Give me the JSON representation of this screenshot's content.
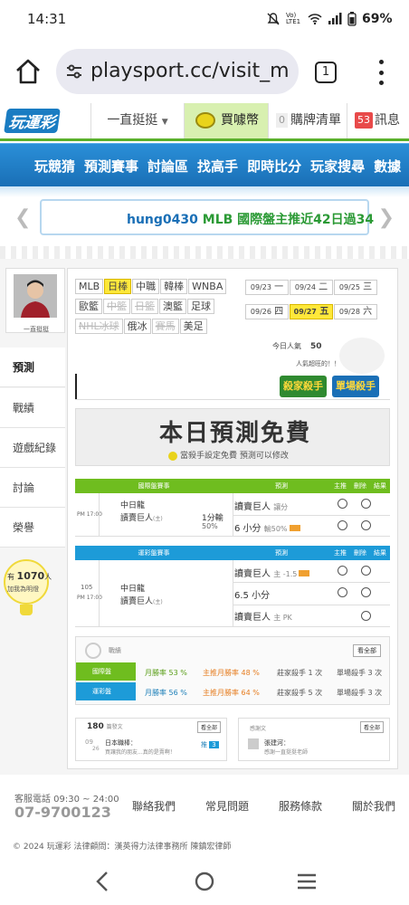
{
  "status": {
    "time": "14:31",
    "signal_text": "Vo) LTE1",
    "battery": "69%"
  },
  "browser": {
    "url": "playsport.cc/visit_m",
    "tab_count": "1"
  },
  "site": {
    "logo": "玩運彩",
    "dropdown": "一直挺挺",
    "buy": "買噱幣",
    "cart_count": "0",
    "cart": "購牌清單",
    "msg_count": "53",
    "msg": "訊息"
  },
  "nav": [
    "玩競猜",
    "預測賽事",
    "討論區",
    "找高手",
    "即時比分",
    "玩家搜尋",
    "數據"
  ],
  "ticker": {
    "user": "hung0430",
    "text": "MLB 國際盤主推近42日過34"
  },
  "profile": {
    "name": "一直挺挺"
  },
  "sidebar": [
    "預測",
    "戰績",
    "遊戲紀錄",
    "討論",
    "榮譽"
  ],
  "bulb": {
    "count": "1070",
    "unit": "人",
    "line2": "加我為明燈"
  },
  "leagues": [
    {
      "label": "MLB",
      "state": "normal"
    },
    {
      "label": "日棒",
      "state": "selected"
    },
    {
      "label": "中職",
      "state": "normal"
    },
    {
      "label": "韓棒",
      "state": "normal"
    },
    {
      "label": "WNBA",
      "state": "normal"
    },
    {
      "label": "歐籃",
      "state": "normal"
    },
    {
      "label": "中籃",
      "state": "disabled"
    },
    {
      "label": "日籃",
      "state": "disabled"
    },
    {
      "label": "澳籃",
      "state": "normal"
    },
    {
      "label": "足球",
      "state": "normal"
    },
    {
      "label": "NHL冰球",
      "state": "disabled"
    },
    {
      "label": "俄冰",
      "state": "normal"
    },
    {
      "label": "賽馬",
      "state": "disabled"
    },
    {
      "label": "美足",
      "state": "normal"
    }
  ],
  "dates": [
    {
      "d": "09/23",
      "w": "一",
      "sel": false
    },
    {
      "d": "09/24",
      "w": "二",
      "sel": false
    },
    {
      "d": "09/25",
      "w": "三",
      "sel": false
    },
    {
      "d": "09/26",
      "w": "四",
      "sel": false
    },
    {
      "d": "09/27",
      "w": "五",
      "sel": true
    },
    {
      "d": "09/28",
      "w": "六",
      "sel": false
    }
  ],
  "today": {
    "label": "今日人氣",
    "value": "50"
  },
  "intro": "人氣超旺的！！",
  "badges": [
    "殺家殺手",
    "單場殺手"
  ],
  "free": {
    "title": "本日預測免費",
    "sub": "當殺手設定免費 預測可以修改"
  },
  "intl": {
    "headers": [
      "國際盤賽事",
      "預測",
      "主推",
      "刪除",
      "結果"
    ],
    "time": "PM 17:00",
    "team1": "中日龍",
    "team2": "讀賣巨人",
    "team2_tag": "(主)",
    "line": "1分輸",
    "pct": "50%",
    "pick1": "讀賣巨人",
    "pick1_sub": "讓分",
    "pick2": "6 小分",
    "pick2_sub": "輸50%"
  },
  "lottery": {
    "headers": [
      "運彩盤賽事",
      "預測",
      "主推",
      "刪除",
      "結果"
    ],
    "no": "105",
    "time": "PM 17:00",
    "team1": "中日龍",
    "team2": "讀賣巨人",
    "team2_tag": "(主)",
    "pick1": "讀賣巨人",
    "pick1_sub": "主 -1.5",
    "pick2": "6.5 小分",
    "pick3": "讀賣巨人",
    "pick3_sub": "主 PK"
  },
  "stats": {
    "title": "戰績",
    "more": "看全部",
    "rows": [
      {
        "label": "國際盤",
        "c1": "月勝率 53 %",
        "c2": "主推月勝率 48 %",
        "c3": "莊家殺手 1 次",
        "c4": "單場殺手 3 次"
      },
      {
        "label": "運彩盤",
        "c1": "月勝率 56 %",
        "c2": "主推月勝率 64 %",
        "c3": "莊家殺手 5 次",
        "c4": "單場殺手 3 次"
      }
    ]
  },
  "box_left": {
    "count": "180",
    "unit": "篇發文",
    "more": "看全部",
    "date1": "09",
    "date2": "26",
    "title": "日本職棒：",
    "desc": "買讓我的朋友...真的是賣啊！",
    "tag": "推",
    "num": "3"
  },
  "box_right": {
    "label": "感謝文",
    "more": "看全部",
    "title": "張建河：",
    "desc": "感謝一直挺挺老師"
  },
  "footer": {
    "hours": "客服電話 09:30 ~ 24:00",
    "phone": "07-9700123",
    "links": [
      "聯絡我們",
      "常見問題",
      "服務條款",
      "關於我們"
    ],
    "copy": "© 2024 玩運彩 法律顧問：漢英得力法律事務所 陳鎮宏律師"
  },
  "colors": {
    "green": "#6fbd1f",
    "blue": "#1d9bd8",
    "yellow": "#ffe83a",
    "nav": "#1a6fb6"
  }
}
